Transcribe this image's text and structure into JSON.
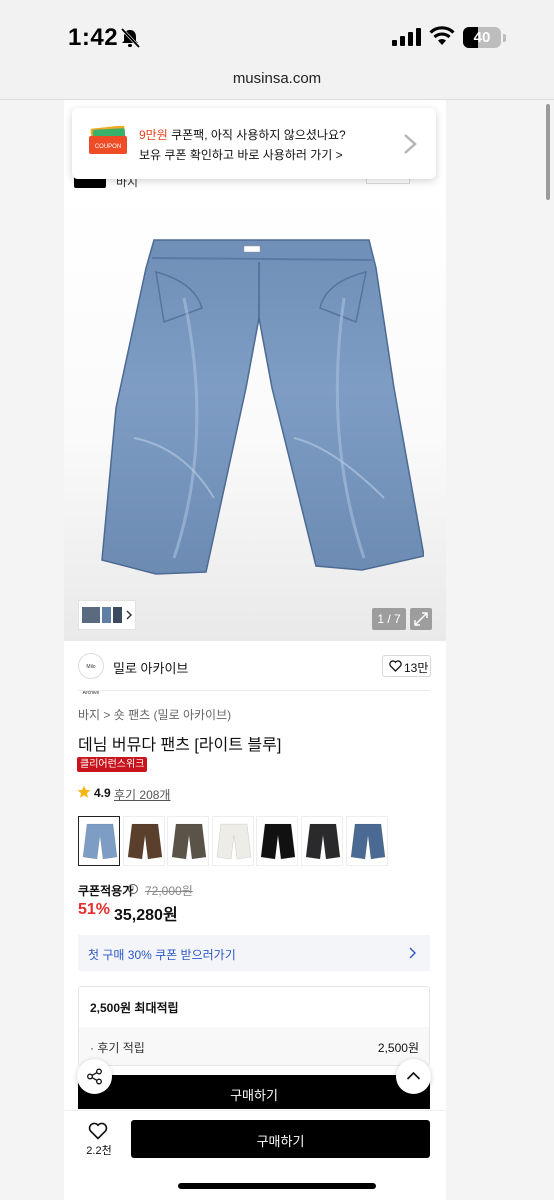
{
  "status_bar": {
    "time": "1:42",
    "battery": "40",
    "battery_level": 0.4
  },
  "browser": {
    "url": "musinsa.com"
  },
  "coupon_popup": {
    "line1_highlight": "9만원",
    "line1_rest": " 쿠폰팩, 아직 사용하지 않으셨나요?",
    "line2": "보유 쿠폰 확인하고 바로 사용하러 가기 >",
    "icon_text": "COUPON"
  },
  "header_partial": {
    "category_text": "바지"
  },
  "gallery": {
    "counter": "1 / 7"
  },
  "brand": {
    "name": "밀로 아카이브",
    "logo_text": "Milo Archive",
    "likes": "13만"
  },
  "product": {
    "breadcrumb": "바지 > 숏 팬츠 (밀로 아카이브)",
    "title": "데님 버뮤다 팬츠 [라이트 블루]",
    "badge": "클리어런스위크",
    "rating": "4.9",
    "reviews": "후기 208개"
  },
  "color_options": [
    {
      "name": "light-blue",
      "color": "#7d9dc4",
      "selected": true
    },
    {
      "name": "brown",
      "color": "#5a3f2d",
      "selected": false
    },
    {
      "name": "khaki-wash",
      "color": "#5a5448",
      "selected": false
    },
    {
      "name": "ivory",
      "color": "#eeece6",
      "selected": false
    },
    {
      "name": "black",
      "color": "#111111",
      "selected": false
    },
    {
      "name": "black-wash",
      "color": "#2a2a2c",
      "selected": false
    },
    {
      "name": "dark-blue",
      "color": "#4a6a94",
      "selected": false
    }
  ],
  "price": {
    "label": "쿠폰적용가",
    "info_icon": "i",
    "original": "72,000원",
    "discount": "51%",
    "sale": "35,280원"
  },
  "coupon_banner": {
    "text": "첫 구매 30% 쿠폰 받으러가기"
  },
  "points": {
    "title": "2,500원 최대적립",
    "review_label": "· 후기 적립",
    "review_value": "2,500원"
  },
  "actions": {
    "buy_top": "구매하기",
    "buy": "구매하기",
    "wish_count": "2.2천"
  },
  "colors": {
    "accent_red": "#e52d2d",
    "link_blue": "#2b56c6",
    "badge_red": "#c8141c"
  }
}
